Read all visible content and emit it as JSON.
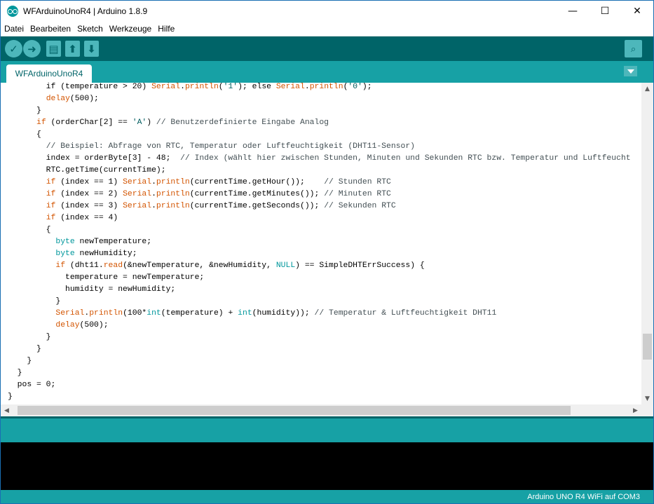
{
  "window": {
    "title": "WFArduinoUnoR4 | Arduino 1.8.9",
    "minimize_glyph": "—",
    "maximize_glyph": "☐",
    "close_glyph": "✕"
  },
  "menu": {
    "items": [
      {
        "label": "Datei"
      },
      {
        "label": "Bearbeiten"
      },
      {
        "label": "Sketch"
      },
      {
        "label": "Werkzeuge"
      },
      {
        "label": "Hilfe"
      }
    ]
  },
  "toolbar": {
    "verify_icon": "checkmark-icon",
    "upload_icon": "arrow-right-icon",
    "new_icon": "new-file-icon",
    "open_icon": "arrow-up-icon",
    "save_icon": "arrow-down-icon",
    "serial_monitor_icon": "magnifier-icon",
    "verify_glyph": "✓",
    "upload_glyph": "➜",
    "new_glyph": "▤",
    "open_glyph": "⬆",
    "save_glyph": "⬇",
    "serial_glyph": "⌕"
  },
  "tabs": {
    "active": "WFArduinoUnoR4"
  },
  "editor": {
    "lines": [
      [
        {
          "t": "        if (temperature > 20) "
        },
        {
          "t": "Serial",
          "c": "kw"
        },
        {
          "t": "."
        },
        {
          "t": "println",
          "c": "kw"
        },
        {
          "t": "("
        },
        {
          "t": "'1'",
          "c": "st"
        },
        {
          "t": "); else "
        },
        {
          "t": "Serial",
          "c": "kw"
        },
        {
          "t": "."
        },
        {
          "t": "println",
          "c": "kw"
        },
        {
          "t": "("
        },
        {
          "t": "'0'",
          "c": "st"
        },
        {
          "t": ");"
        }
      ],
      [
        {
          "t": "        "
        },
        {
          "t": "delay",
          "c": "kw"
        },
        {
          "t": "(500);"
        }
      ],
      [
        {
          "t": "      }"
        }
      ],
      [
        {
          "t": "      "
        },
        {
          "t": "if",
          "c": "kw"
        },
        {
          "t": " (orderChar[2] == "
        },
        {
          "t": "'A'",
          "c": "st"
        },
        {
          "t": ") "
        },
        {
          "t": "// Benutzerdefinierte Eingabe Analog",
          "c": "cm"
        }
      ],
      [
        {
          "t": "      {"
        }
      ],
      [
        {
          "t": "        "
        },
        {
          "t": "// Beispiel: Abfrage von RTC, Temperatur oder Luftfeuchtigkeit (DHT11-Sensor)",
          "c": "cm"
        }
      ],
      [
        {
          "t": "        index = orderByte[3] - 48;  "
        },
        {
          "t": "// Index (wählt hier zwischen Stunden, Minuten und Sekunden RTC bzw. Temperatur und Luftfeucht",
          "c": "cm"
        }
      ],
      [
        {
          "t": "        RTC.getTime(currentTime);"
        }
      ],
      [
        {
          "t": "        "
        },
        {
          "t": "if",
          "c": "kw"
        },
        {
          "t": " (index == 1) "
        },
        {
          "t": "Serial",
          "c": "kw"
        },
        {
          "t": "."
        },
        {
          "t": "println",
          "c": "kw"
        },
        {
          "t": "(currentTime.getHour());    "
        },
        {
          "t": "// Stunden RTC",
          "c": "cm"
        }
      ],
      [
        {
          "t": "        "
        },
        {
          "t": "if",
          "c": "kw"
        },
        {
          "t": " (index == 2) "
        },
        {
          "t": "Serial",
          "c": "kw"
        },
        {
          "t": "."
        },
        {
          "t": "println",
          "c": "kw"
        },
        {
          "t": "(currentTime.getMinutes()); "
        },
        {
          "t": "// Minuten RTC",
          "c": "cm"
        }
      ],
      [
        {
          "t": "        "
        },
        {
          "t": "if",
          "c": "kw"
        },
        {
          "t": " (index == 3) "
        },
        {
          "t": "Serial",
          "c": "kw"
        },
        {
          "t": "."
        },
        {
          "t": "println",
          "c": "kw"
        },
        {
          "t": "(currentTime.getSeconds()); "
        },
        {
          "t": "// Sekunden RTC",
          "c": "cm"
        }
      ],
      [
        {
          "t": "        "
        },
        {
          "t": "if",
          "c": "kw"
        },
        {
          "t": " (index == 4)"
        }
      ],
      [
        {
          "t": "        {"
        }
      ],
      [
        {
          "t": "          "
        },
        {
          "t": "byte",
          "c": "kw2"
        },
        {
          "t": " newTemperature;"
        }
      ],
      [
        {
          "t": "          "
        },
        {
          "t": "byte",
          "c": "kw2"
        },
        {
          "t": " newHumidity;"
        }
      ],
      [
        {
          "t": "          "
        },
        {
          "t": "if",
          "c": "kw"
        },
        {
          "t": " (dht11."
        },
        {
          "t": "read",
          "c": "kw"
        },
        {
          "t": "(&newTemperature, &newHumidity, "
        },
        {
          "t": "NULL",
          "c": "kw2"
        },
        {
          "t": ") == SimpleDHTErrSuccess) {"
        }
      ],
      [
        {
          "t": "            temperature = newTemperature;"
        }
      ],
      [
        {
          "t": "            humidity = newHumidity;"
        }
      ],
      [
        {
          "t": "          }"
        }
      ],
      [
        {
          "t": "          "
        },
        {
          "t": "Serial",
          "c": "kw"
        },
        {
          "t": "."
        },
        {
          "t": "println",
          "c": "kw"
        },
        {
          "t": "(100*"
        },
        {
          "t": "int",
          "c": "kw2"
        },
        {
          "t": "(temperature) + "
        },
        {
          "t": "int",
          "c": "kw2"
        },
        {
          "t": "(humidity)); "
        },
        {
          "t": "// Temperatur & Luftfeuchtigkeit DHT11",
          "c": "cm"
        }
      ],
      [
        {
          "t": "          "
        },
        {
          "t": "delay",
          "c": "kw"
        },
        {
          "t": "(500);"
        }
      ],
      [
        {
          "t": "        }"
        }
      ],
      [
        {
          "t": "      }"
        }
      ],
      [
        {
          "t": "    }"
        }
      ],
      [
        {
          "t": "  }"
        }
      ],
      [
        {
          "t": "  pos = 0;"
        }
      ],
      [
        {
          "t": "}"
        }
      ]
    ]
  },
  "scroll": {
    "up_glyph": "▲",
    "down_glyph": "▼",
    "left_glyph": "◀",
    "right_glyph": "▶",
    "vertical_position": 0.88
  },
  "status": {
    "board": "Arduino UNO R4 WiFi auf COM3"
  }
}
